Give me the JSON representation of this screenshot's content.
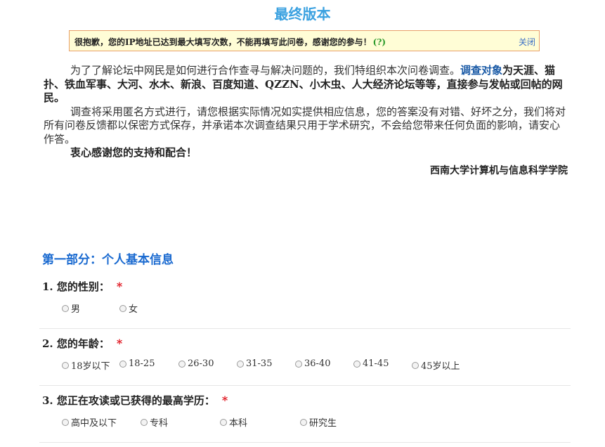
{
  "page": {
    "title": "最终版本"
  },
  "notice": {
    "message": "很抱歉，您的IP地址已达到最大填写次数，不能再填写此问卷，感谢您的参与！",
    "help": "(?)",
    "close_label": "关闭"
  },
  "intro": {
    "p1_pre": "为了了解论坛中网民是如何进行合作查寻与解决问题的，我们特组织本次问卷调查。",
    "p1_link": "调查对象",
    "p1_bold": "为天涯、猫扑、铁血军事、大河、水木、新浪、百度知道、QZZN、小木虫、人大经济论坛等等，直接参与发帖或回帖的网民。",
    "p2": "调查将采用匿名方式进行，请您根据实际情况如实提供相应信息，您的答案没有对错、好坏之分，我们将对所有问卷反馈都以保密方式保存，并承诺本次调查结果只用于学术研究，不会给您带来任何负面的影响，请安心作答。",
    "p3": "衷心感谢您的支持和配合！",
    "signature": "西南大学计算机与信息科学学院"
  },
  "section": {
    "title": "第一部分：个人基本信息"
  },
  "questions": [
    {
      "label": "1. 您的性别：",
      "required_mark": "*",
      "options": [
        "男",
        "女"
      ]
    },
    {
      "label": "2. 您的年龄：",
      "required_mark": "*",
      "options": [
        "18岁以下",
        "18-25",
        "26-30",
        "31-35",
        "36-40",
        "41-45",
        "45岁以上"
      ]
    },
    {
      "label": "3. 您正在攻读或已获得的最高学历：",
      "required_mark": "*",
      "options": [
        "高中及以下",
        "专科",
        "本科",
        "研究生"
      ]
    }
  ]
}
